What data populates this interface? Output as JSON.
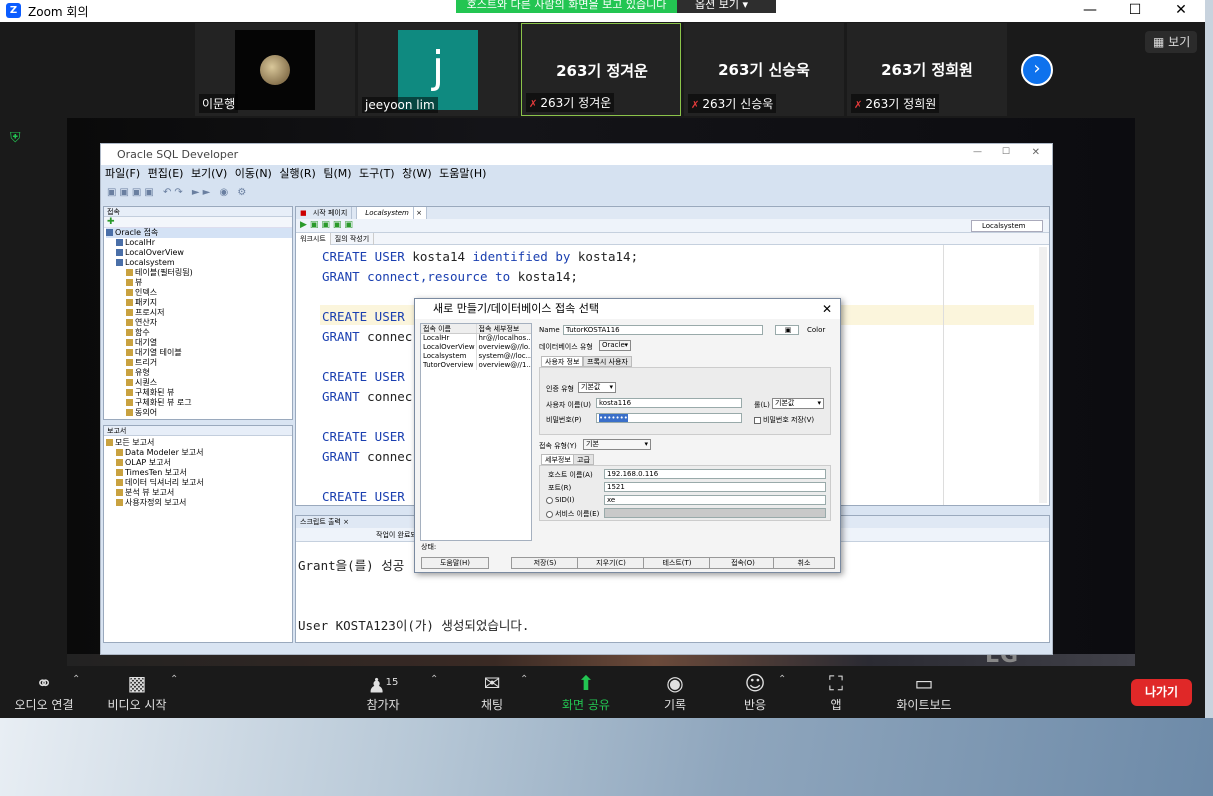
{
  "zoom": {
    "title": "Zoom 회의",
    "banner": "호스트와 다른 사람의 화면을 보고 있습니다",
    "view_options": "옵션 보기",
    "view_button": "보기"
  },
  "participants": [
    {
      "name": "이문행",
      "type": "moon"
    },
    {
      "name": "jeeyoon lim",
      "type": "initial",
      "initial": "j"
    },
    {
      "name": "263기 정겨운",
      "big": "263기 정겨운",
      "muted": true
    },
    {
      "name": "263기 신승욱",
      "big": "263기 신승욱",
      "muted": true
    },
    {
      "name": "263기 정희원",
      "big": "263기 정희원",
      "muted": true
    }
  ],
  "sqldev": {
    "title": "Oracle SQL Developer",
    "menu": [
      "파일(F)",
      "편집(E)",
      "보기(V)",
      "이동(N)",
      "실행(R)",
      "팀(M)",
      "도구(T)",
      "창(W)",
      "도움말(H)"
    ],
    "left_panel_title": "접속",
    "tree": [
      "Oracle 접속",
      "LocalHr",
      "LocalOverView",
      "Localsystem",
      "테이블(필터링됨)",
      "뷰",
      "인덱스",
      "패키지",
      "프로시저",
      "연산자",
      "함수",
      "대기열",
      "대기열 테이블",
      "트리거",
      "유형",
      "시퀀스",
      "구체화된 뷰",
      "구체화된 뷰 로그",
      "동의어"
    ],
    "report_title": "보고서",
    "reports": [
      "모든 보고서",
      "Data Modeler 보고서",
      "OLAP 보고서",
      "TimesTen 보고서",
      "데이터 딕셔너리 보고서",
      "분석 뷰 보고서",
      "사용자정의 보고서"
    ],
    "editor_tabs": [
      "시작 페이지",
      "Localsystem"
    ],
    "connection": "Localsystem",
    "sub_tabs": [
      "워크시트",
      "질의 작성기"
    ],
    "code": [
      [
        "CREATE USER",
        " kosta14 ",
        "identified by",
        " kosta14;"
      ],
      [
        "GRANT",
        " connect,resource ",
        "to",
        " kosta14;"
      ],
      [
        "",
        "",
        "",
        ""
      ],
      [
        "CREATE USER",
        "",
        "",
        ""
      ],
      [
        "GRANT",
        " connec",
        "",
        ""
      ],
      [
        "",
        "",
        "",
        ""
      ],
      [
        "CREATE USER",
        "",
        "",
        ""
      ],
      [
        "GRANT",
        " connec",
        "",
        ""
      ],
      [
        "",
        "",
        "",
        ""
      ],
      [
        "CREATE USER",
        "",
        "",
        ""
      ],
      [
        "GRANT",
        " connec",
        "",
        ""
      ],
      [
        "",
        "",
        "",
        ""
      ],
      [
        "CREATE USER",
        "",
        "",
        ""
      ]
    ],
    "output_tab": "스크립트 출력",
    "output_toolbar": "작업이 완료되었",
    "output_lines": [
      "Grant을(를) 성공",
      "",
      "",
      "User KOSTA123이(가) 생성되었습니다."
    ]
  },
  "dialog": {
    "title": "새로 만들기/데이터베이스 접속 선택",
    "list_headers": [
      "접속 이름",
      "접속 세부정보"
    ],
    "list_rows": [
      [
        "LocalHr",
        "hr@//localhos..."
      ],
      [
        "LocalOverView",
        "overview@//lo..."
      ],
      [
        "Localsystem",
        "system@//loc..."
      ],
      [
        "TutorOverview",
        "overview@//1..."
      ]
    ],
    "name_label": "Name",
    "name_value": "TutorKOSTA116",
    "color_label": "Color",
    "db_type_label": "데이터베이스 유형",
    "db_type_value": "Oracle",
    "tabs": [
      "사용자 정보",
      "프록시 사용자"
    ],
    "auth_label": "인증 유형",
    "auth_value": "기본값",
    "user_label": "사용자 이름(U)",
    "user_value": "kosta116",
    "role_label": "롤(L)",
    "role_value": "기본값",
    "pass_label": "비밀번호(P)",
    "pass_value": "•••••••",
    "save_pass": "비밀번호 저장(V)",
    "conn_type_label": "접속 유형(Y)",
    "conn_type_value": "기본",
    "detail_tabs": [
      "세부정보",
      "고급"
    ],
    "host_label": "호스트 이름(A)",
    "host_value": "192.168.0.116",
    "port_label": "포트(R)",
    "port_value": "1521",
    "sid_label": "SID(I)",
    "sid_value": "xe",
    "service_label": "서비스 이름(E)",
    "status_label": "상태:",
    "buttons": [
      "도움말(H)",
      "저장(S)",
      "지우기(C)",
      "테스트(T)",
      "접속(O)",
      "취소"
    ]
  },
  "controls": {
    "audio": "오디오 연결",
    "video": "비디오 시작",
    "participants": "참가자",
    "participant_count": "15",
    "chat": "채팅",
    "share": "화면 공유",
    "record": "기록",
    "reactions": "반응",
    "apps": "앱",
    "whiteboard": "화이트보드",
    "leave": "나가기"
  },
  "brand_watermark": "LG"
}
